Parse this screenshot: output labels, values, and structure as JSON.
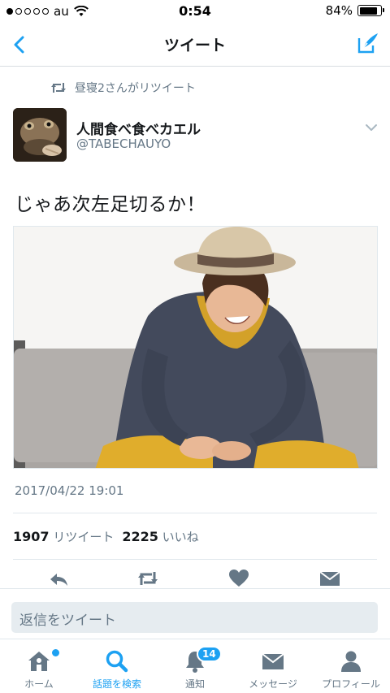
{
  "status_bar": {
    "carrier": "au",
    "time": "0:54",
    "battery_text": "84%",
    "battery_level": 0.84,
    "signal_bars_filled": 1,
    "signal_bars_total": 5
  },
  "nav": {
    "title": "ツイート",
    "back_icon": "chevron-left-icon",
    "compose_icon": "compose-tweet-icon"
  },
  "retweet_context": {
    "text": "昼寝2さんがリツイート"
  },
  "tweet": {
    "display_name": "人間食べ食べカエル",
    "screen_name": "@TABECHAUYO",
    "text": "じゃあ次左足切るか！",
    "timestamp": "2017/04/22 19:01",
    "retweet_count": "1907",
    "retweet_label": "リツイート",
    "like_count": "2225",
    "like_label": "いいね"
  },
  "reply": {
    "placeholder": "返信をツイート"
  },
  "tabs": [
    {
      "label": "ホーム",
      "icon": "home-icon"
    },
    {
      "label": "話題を検索",
      "icon": "search-icon",
      "active": true
    },
    {
      "label": "通知",
      "icon": "bell-icon",
      "badge": "14"
    },
    {
      "label": "メッセージ",
      "icon": "envelope-icon"
    },
    {
      "label": "プロフィール",
      "icon": "person-icon"
    }
  ],
  "colors": {
    "accent": "#1da1f2",
    "secondary_text": "#657786",
    "primary_text": "#14171a"
  }
}
